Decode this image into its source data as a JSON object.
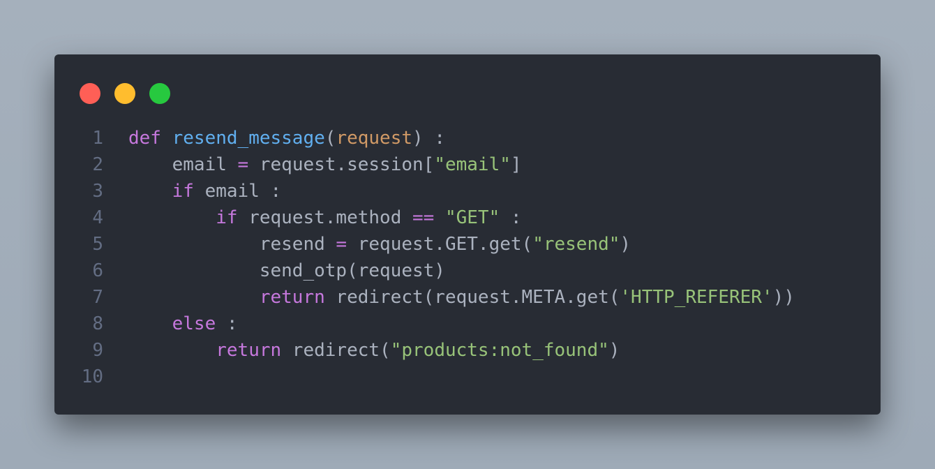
{
  "colors": {
    "background": "#a1acb8",
    "window": "#282c34",
    "dot_red": "#ff5f56",
    "dot_yellow": "#ffbd2e",
    "dot_green": "#27c93f",
    "line_number": "#636d83",
    "keyword": "#c678dd",
    "function": "#61afef",
    "parameter": "#d19a66",
    "string": "#98c379",
    "plain": "#abb2bf"
  },
  "window_controls": [
    {
      "name": "close",
      "color": "#ff5f56"
    },
    {
      "name": "minimize",
      "color": "#ffbd2e"
    },
    {
      "name": "maximize",
      "color": "#27c93f"
    }
  ],
  "code": {
    "language": "python",
    "lines": [
      {
        "number": "1",
        "tokens": [
          {
            "t": "def",
            "k": "kw"
          },
          {
            "t": " ",
            "k": "plain"
          },
          {
            "t": "resend_message",
            "k": "fn"
          },
          {
            "t": "(",
            "k": "plain"
          },
          {
            "t": "request",
            "k": "param"
          },
          {
            "t": ") :",
            "k": "plain"
          }
        ]
      },
      {
        "number": "2",
        "tokens": [
          {
            "t": "    email ",
            "k": "plain"
          },
          {
            "t": "=",
            "k": "op"
          },
          {
            "t": " request.session[",
            "k": "plain"
          },
          {
            "t": "\"email\"",
            "k": "str"
          },
          {
            "t": "]",
            "k": "plain"
          }
        ]
      },
      {
        "number": "3",
        "tokens": [
          {
            "t": "    ",
            "k": "plain"
          },
          {
            "t": "if",
            "k": "kw"
          },
          {
            "t": " email :",
            "k": "plain"
          }
        ]
      },
      {
        "number": "4",
        "tokens": [
          {
            "t": "        ",
            "k": "plain"
          },
          {
            "t": "if",
            "k": "kw"
          },
          {
            "t": " request.method ",
            "k": "plain"
          },
          {
            "t": "==",
            "k": "op"
          },
          {
            "t": " ",
            "k": "plain"
          },
          {
            "t": "\"GET\"",
            "k": "str"
          },
          {
            "t": " :",
            "k": "plain"
          }
        ]
      },
      {
        "number": "5",
        "tokens": [
          {
            "t": "            resend ",
            "k": "plain"
          },
          {
            "t": "=",
            "k": "op"
          },
          {
            "t": " request.GET.get(",
            "k": "plain"
          },
          {
            "t": "\"resend\"",
            "k": "str"
          },
          {
            "t": ")",
            "k": "plain"
          }
        ]
      },
      {
        "number": "6",
        "tokens": [
          {
            "t": "            send_otp(request)",
            "k": "plain"
          }
        ]
      },
      {
        "number": "7",
        "tokens": [
          {
            "t": "            ",
            "k": "plain"
          },
          {
            "t": "return",
            "k": "kw"
          },
          {
            "t": " redirect(request.META.get(",
            "k": "plain"
          },
          {
            "t": "'HTTP_REFERER'",
            "k": "str"
          },
          {
            "t": "))",
            "k": "plain"
          }
        ]
      },
      {
        "number": "8",
        "tokens": [
          {
            "t": "    ",
            "k": "plain"
          },
          {
            "t": "else",
            "k": "kw"
          },
          {
            "t": " :",
            "k": "plain"
          }
        ]
      },
      {
        "number": "9",
        "tokens": [
          {
            "t": "        ",
            "k": "plain"
          },
          {
            "t": "return",
            "k": "kw"
          },
          {
            "t": " redirect(",
            "k": "plain"
          },
          {
            "t": "\"products:not_found\"",
            "k": "str"
          },
          {
            "t": ")",
            "k": "plain"
          }
        ]
      },
      {
        "number": "10",
        "tokens": []
      }
    ]
  }
}
